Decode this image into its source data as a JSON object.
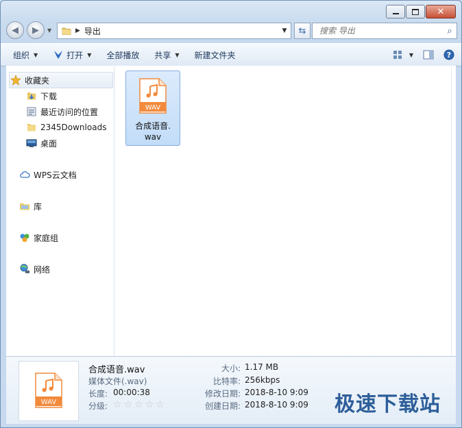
{
  "window": {
    "caption": {
      "minimize": "minimize",
      "maximize": "maximize",
      "close": "close"
    }
  },
  "nav": {
    "back_icon": "back-arrow-icon",
    "forward_icon": "forward-arrow-icon",
    "breadcrumb": [
      "导出"
    ],
    "search_placeholder": "搜索 导出"
  },
  "toolbar": {
    "organize": "组织",
    "open": "打开",
    "play_all": "全部播放",
    "share": "共享",
    "new_folder": "新建文件夹"
  },
  "sidebar": {
    "favorites": {
      "label": "收藏夹",
      "items": [
        {
          "label": "下载",
          "icon": "download-folder-icon"
        },
        {
          "label": "最近访问的位置",
          "icon": "recent-places-icon"
        },
        {
          "label": "2345Downloads",
          "icon": "folder-icon"
        },
        {
          "label": "桌面",
          "icon": "desktop-icon"
        }
      ]
    },
    "groups": [
      {
        "label": "WPS云文档",
        "icon": "cloud-icon"
      },
      {
        "label": "库",
        "icon": "library-icon"
      },
      {
        "label": "家庭组",
        "icon": "homegroup-icon"
      },
      {
        "label": "网络",
        "icon": "network-icon"
      }
    ]
  },
  "files": [
    {
      "name_line1": "合成语音.",
      "name_line2": "wav",
      "badge": "WAV",
      "selected": true
    }
  ],
  "details": {
    "filename": "合成语音.wav",
    "type": "媒体文件(.wav)",
    "length_label": "长度:",
    "length_value": "00:00:38",
    "rating_label": "分级:",
    "rating_value": 0,
    "size_label": "大小:",
    "size_value": "1.17 MB",
    "bitrate_label": "比特率:",
    "bitrate_value": "256kbps",
    "modified_label": "修改日期:",
    "modified_value": "2018-8-10 9:09",
    "created_label": "创建日期:",
    "created_value": "2018-8-10 9:09",
    "thumb_badge": "WAV"
  },
  "watermark": "极速下载站",
  "colors": {
    "accent": "#2d5e99",
    "file_icon": "#f28a3c",
    "selection": "#cce1fb"
  }
}
